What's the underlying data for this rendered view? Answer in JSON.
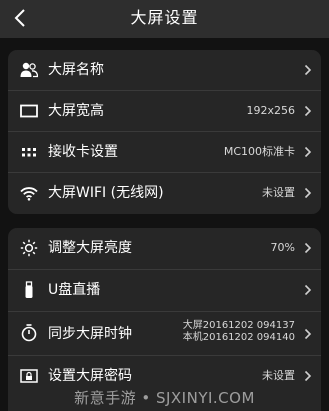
{
  "header": {
    "title": "大屏设置",
    "back_icon": "back-arrow-icon"
  },
  "group1": [
    {
      "label": "大屏名称",
      "value": "",
      "icon": "users-icon"
    },
    {
      "label": "大屏宽高",
      "value": "192x256",
      "icon": "rectangle-icon"
    },
    {
      "label": "接收卡设置",
      "value": "MC100标准卡",
      "icon": "grid-dots-icon"
    },
    {
      "label": "大屏WIFI (无线网)",
      "value": "未设置",
      "icon": "wifi-icon"
    }
  ],
  "group2": [
    {
      "label": "调整大屏亮度",
      "value": "70%",
      "icon": "brightness-icon"
    },
    {
      "label": "U盘直播",
      "value": "",
      "icon": "usb-drive-icon"
    },
    {
      "label": "同步大屏时钟",
      "value_line1": "大屏20161202 094137",
      "value_line2": "本机20161202 094140",
      "icon": "stopwatch-icon"
    },
    {
      "label": "设置大屏密码",
      "value": "未设置",
      "icon": "lock-screen-icon"
    }
  ],
  "watermark": "新意手游 • SJXINYI.COM"
}
